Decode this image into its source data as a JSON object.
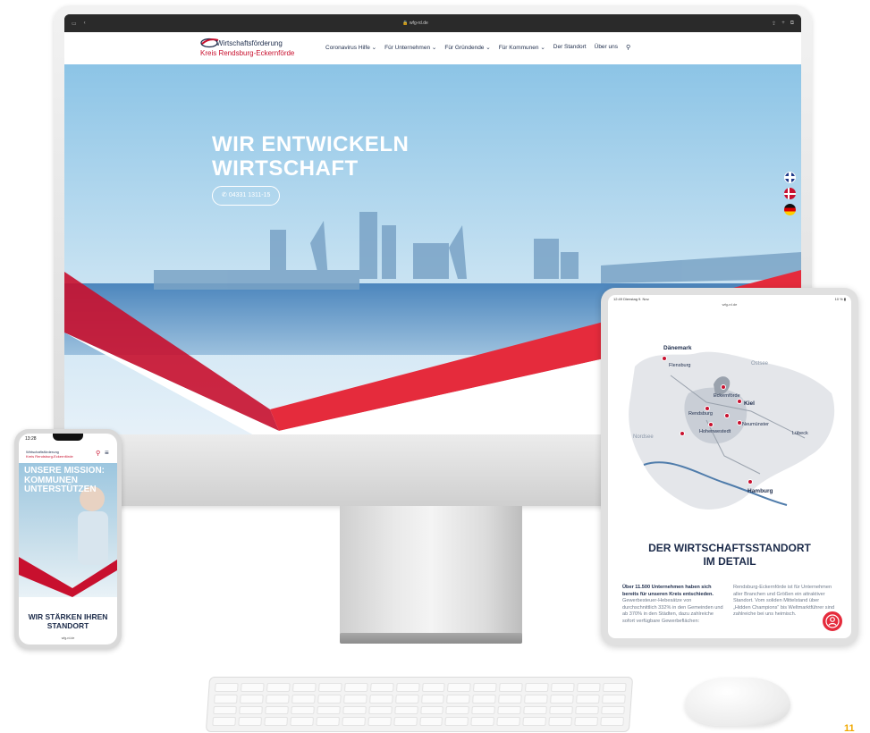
{
  "browser": {
    "url": "wfg-rd.de"
  },
  "site": {
    "logo_line1": "Wirtschaftsförderung",
    "logo_line2": "Kreis Rendsburg-Eckernförde",
    "nav": [
      {
        "label": "Coronavirus Hilfe",
        "has_dropdown": true
      },
      {
        "label": "Für Unternehmen",
        "has_dropdown": true
      },
      {
        "label": "Für Gründende",
        "has_dropdown": true
      },
      {
        "label": "Für Kommunen",
        "has_dropdown": true
      },
      {
        "label": "Der Standort",
        "has_dropdown": false
      },
      {
        "label": "Über uns",
        "has_dropdown": false
      }
    ],
    "search_icon": "search-icon",
    "hero_title_line1": "WIR ENTWICKELN",
    "hero_title_line2": "WIRTSCHAFT",
    "hero_phone": "04331 1311-15",
    "languages": [
      "english-flag",
      "danish-flag",
      "german-flag"
    ]
  },
  "tablet": {
    "status_time": "12:49",
    "status_date": "Dienstag 9. Nov.",
    "status_battery": "10 %",
    "url": "wfg-rd.de",
    "map_labels": {
      "denmark": "Dänemark",
      "flensburg": "Flensburg",
      "ostsee": "Ostsee",
      "nordsee": "Nordsee",
      "kiel": "Kiel",
      "hamburg": "Hamburg",
      "luebeck": "Lübeck",
      "rendsburg": "Rendsburg",
      "eckernfoerde": "Eckernförde",
      "neumuenster": "Neumünster",
      "hohenwestedt": "Hohenwestedt"
    },
    "heading_line1": "DER WIRTSCHAFTSSTANDORT",
    "heading_line2": "IM DETAIL",
    "col1_bold": "Über 11.500 Unternehmen haben sich bereits für unseren Kreis entschieden.",
    "col1_text": "Gewerbesteuer-Hebesätze von durchschnittlich 332% in den Gemeinden und ab 370% in den Städten, dazu zahlreiche sofort verfügbare Gewerbeflächen:",
    "col2_text": "Rendsburg-Eckernförde ist für Unternehmen aller Branchen und Größen ein attraktiver Standort. Vom soliden Mittelstand über „Hidden Champions“ bis Weltmarktführer sind zahlreiche bei uns heimisch."
  },
  "phone": {
    "time": "13:28",
    "logo_line1": "Wirtschaftsförderung",
    "logo_line2": "Kreis Rendsburg-Eckernförde",
    "hero_line1": "UNSERE MISSION:",
    "hero_line2": "KOMMUNEN",
    "hero_line3": "UNTERSTÜTZEN",
    "bottom_line1": "WIR STÄRKEN IHREN",
    "bottom_line2": "STANDORT",
    "url": "wfg-rd.de"
  },
  "page_number": "11",
  "colors": {
    "brand_red": "#c8102e",
    "brand_navy": "#1c2b4a",
    "accent_yellow": "#f0a800"
  }
}
